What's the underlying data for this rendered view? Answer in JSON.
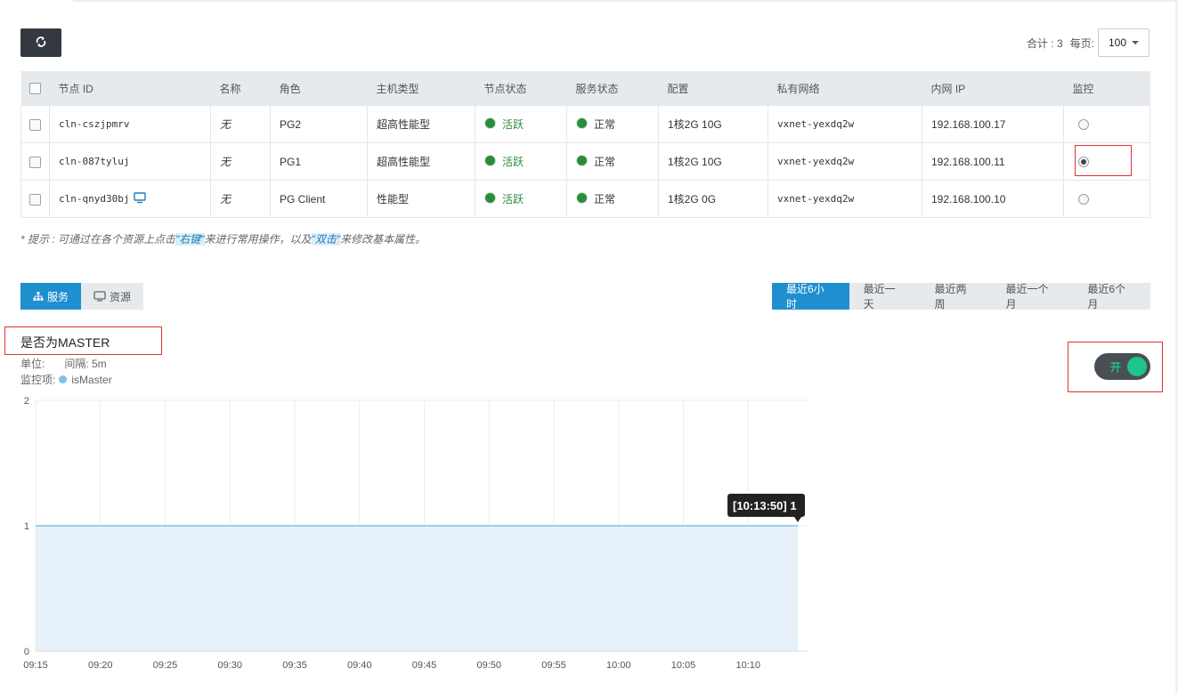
{
  "toolbar": {
    "refresh_icon": "refresh-icon"
  },
  "pager": {
    "total_label": "合计 : 3",
    "per_page_label": "每页:",
    "per_page_value": "100"
  },
  "table": {
    "headers": [
      "节点 ID",
      "名称",
      "角色",
      "主机类型",
      "节点状态",
      "服务状态",
      "配置",
      "私有网络",
      "内网 IP",
      "监控"
    ],
    "rows": [
      {
        "id": "cln-cszjpmrv",
        "name": "无",
        "role": "PG2",
        "host_type": "超高性能型",
        "node_status": "活跃",
        "service_status": "正常",
        "config": "1核2G 10G",
        "vxnet": "vxnet-yexdq2w",
        "ip": "192.168.100.17",
        "monitor_selected": false
      },
      {
        "id": "cln-087tyluj",
        "name": "无",
        "role": "PG1",
        "host_type": "超高性能型",
        "node_status": "活跃",
        "service_status": "正常",
        "config": "1核2G 10G",
        "vxnet": "vxnet-yexdq2w",
        "ip": "192.168.100.11",
        "monitor_selected": true
      },
      {
        "id": "cln-qnyd30bj",
        "name": "无",
        "role": "PG Client",
        "host_type": "性能型",
        "node_status": "活跃",
        "service_status": "正常",
        "config": "1核2G 0G",
        "vxnet": "vxnet-yexdq2w",
        "ip": "192.168.100.10",
        "monitor_selected": false
      }
    ]
  },
  "tip": {
    "prefix": "* 提示 : 可通过在各个资源上点击",
    "hl1": "\"右键\"",
    "mid": "来进行常用操作，以及",
    "hl2": "\"双击\"",
    "suffix": "来修改基本属性。"
  },
  "tabs": {
    "service": "服务",
    "resource": "资源"
  },
  "ranges": [
    "最近6小时",
    "最近一天",
    "最近两周",
    "最近一个月",
    "最近6个月"
  ],
  "chart_header": {
    "title": "是否为MASTER",
    "unit_label": "单位:",
    "interval_label": "间隔: 5m",
    "items_label": "监控项:",
    "series_name": "isMaster"
  },
  "toggle": {
    "label": "开",
    "on": true
  },
  "colors": {
    "accent": "#1f8fd0",
    "active_green": "#2e8b3e",
    "toggle_green": "#1ec58a",
    "series": "#7fc1ea"
  },
  "chart_data": {
    "type": "area",
    "x": [
      "09:15",
      "09:20",
      "09:25",
      "09:30",
      "09:35",
      "09:40",
      "09:45",
      "09:50",
      "09:55",
      "10:00",
      "10:05",
      "10:10",
      "10:13:50"
    ],
    "x_tick_labels": [
      "09:15",
      "09:20",
      "09:25",
      "09:30",
      "09:35",
      "09:40",
      "09:45",
      "09:50",
      "09:55",
      "10:00",
      "10:05",
      "10:10"
    ],
    "series": [
      {
        "name": "isMaster",
        "values": [
          1,
          1,
          1,
          1,
          1,
          1,
          1,
          1,
          1,
          1,
          1,
          1,
          1
        ]
      }
    ],
    "ylim": [
      0,
      2
    ],
    "y_ticks": [
      "0",
      "1",
      "2"
    ],
    "tooltip": {
      "time": "[10:13:50]",
      "value": "1"
    },
    "grid": true
  }
}
